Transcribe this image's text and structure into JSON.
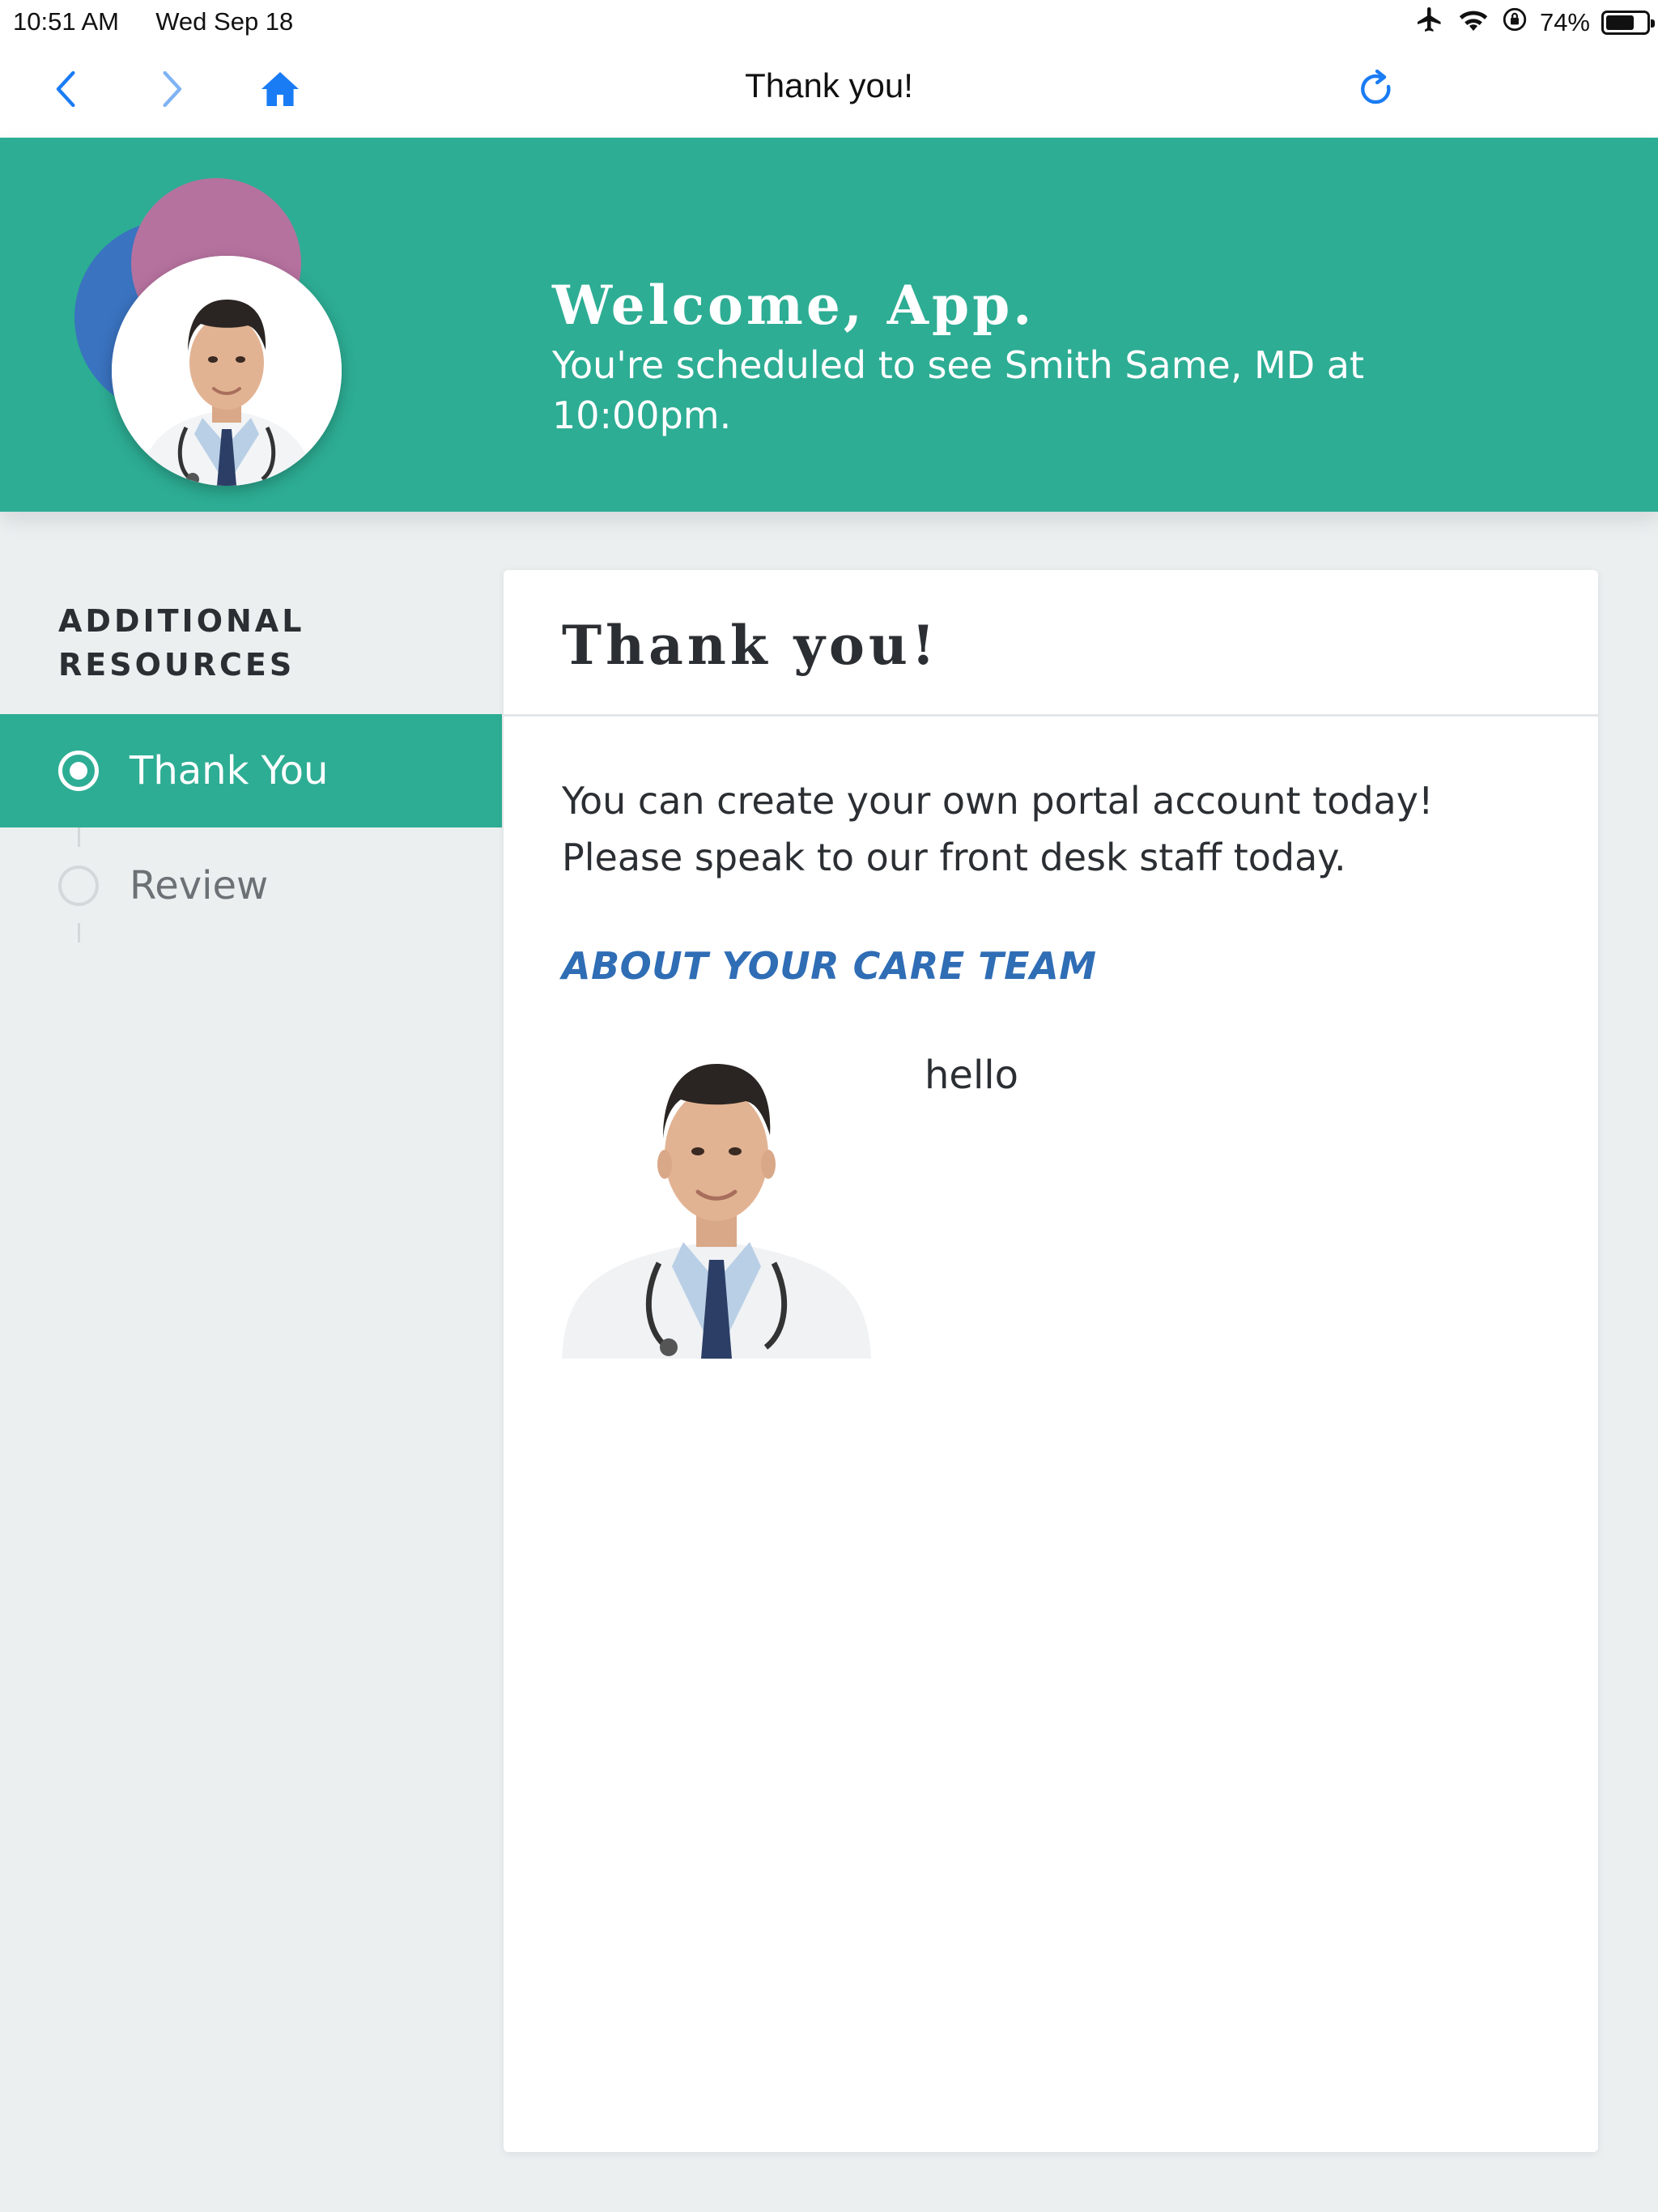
{
  "status_bar": {
    "time": "10:51 AM",
    "date": "Wed Sep 18",
    "battery": "74%",
    "battery_level": 0.74
  },
  "nav": {
    "title": "Thank you!"
  },
  "banner": {
    "welcome": "Welcome, App.",
    "schedule": "You're scheduled to see Smith Same, MD at 10:00pm."
  },
  "sidebar": {
    "heading_line1": "ADDITIONAL",
    "heading_line2": "RESOURCES",
    "items": [
      {
        "label": "Thank You",
        "active": true
      },
      {
        "label": "Review",
        "active": false
      }
    ]
  },
  "card": {
    "title": "Thank you!",
    "body_line1": "You can create your own portal account today!",
    "body_line2": "Please speak to our front desk staff today.",
    "care_heading": "ABOUT YOUR CARE TEAM",
    "care_text": "hello"
  },
  "colors": {
    "accent": "#2dad94",
    "link": "#2f6db5",
    "ios_blue": "#1a7cf5"
  },
  "icons": [
    "back-icon",
    "forward-icon",
    "home-icon",
    "refresh-icon",
    "airplane-icon",
    "wifi-icon",
    "rotation-lock-icon",
    "battery-icon"
  ]
}
